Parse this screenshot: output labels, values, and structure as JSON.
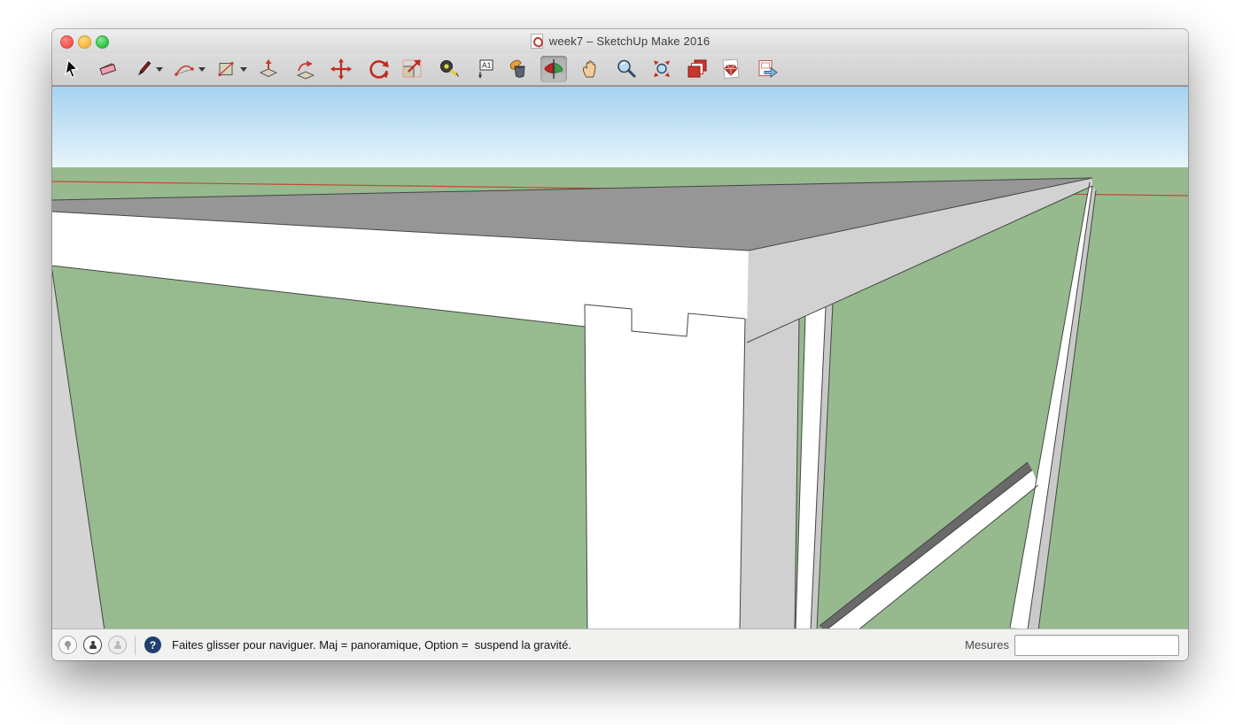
{
  "window": {
    "title": "week7 – SketchUp Make 2016",
    "traffic_lights": [
      "close",
      "minimize",
      "zoom"
    ]
  },
  "toolbar": {
    "active_tool": "orbit",
    "tools": [
      "select",
      "eraser",
      "line",
      "arc",
      "rectangle",
      "push-pull",
      "follow-me",
      "move",
      "rotate",
      "scale",
      "tape-measure",
      "text",
      "paint-bucket",
      "orbit",
      "pan",
      "zoom",
      "zoom-extents",
      "warehouse-models",
      "extension-warehouse",
      "send-to-layout"
    ]
  },
  "viewport": {
    "scene": "3d-model-white-frame-wall-corner-with-green-panels",
    "colors": {
      "sky_top": "#a5d2ef",
      "sky_horizon": "#eef7fc",
      "ground_green": "#96ba8e",
      "slab_top_gray": "#969696",
      "shaded_face_gray": "#d2d2d2",
      "front_face_white": "#ffffff",
      "brace_shadow_gray": "#6a6a6a",
      "edge_line": "#444444",
      "axis_red": "#bf4936"
    }
  },
  "statusbar": {
    "icons": [
      "geolocation-icon",
      "credits-icon",
      "sign-in-icon",
      "help-icon"
    ],
    "help_glyph": "?",
    "status_text": "Faites glisser pour naviguer. Maj = panoramique, Option =  suspend la gravité.",
    "measures_label": "Mesures",
    "measures_value": ""
  }
}
